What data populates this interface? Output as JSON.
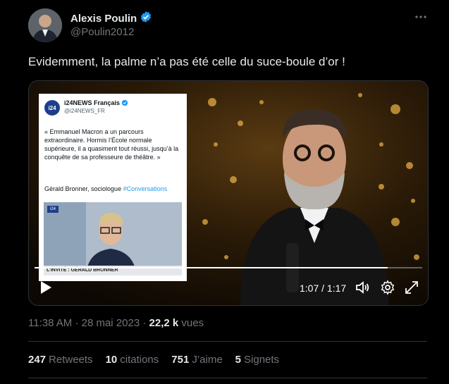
{
  "author": {
    "name": "Alexis Poulin",
    "handle": "@Poulin2012",
    "verified": true
  },
  "tweet_text": "Evidemment, la palme n’a pas été celle du suce-boule d’or !",
  "video": {
    "time_display": "1:07 / 1:17",
    "progress_fraction": 0.91,
    "embedded_card": {
      "account_name": "i24NEWS Français",
      "account_handle": "@i24NEWS_FR",
      "logo_text": "i24",
      "quote": "« Emmanuel Macron a un parcours extraordinaire. Hormis l’École normale supérieure, il a quasiment tout réussi, jusqu’à la conquête de sa professeure de théâtre. »",
      "signature_prefix": "Gérald Bronner, sociologue ",
      "signature_tag": "#Conversations",
      "clip_banner": "L’INVITÉ : GÉRALD BRONNER",
      "clip_badge": "i24"
    }
  },
  "meta": {
    "time": "11:38 AM",
    "separator": "·",
    "date": "28 mai 2023",
    "views_value": "22,2 k",
    "views_label": "vues"
  },
  "stats": {
    "retweets_value": "247",
    "retweets_label": "Retweets",
    "citations_value": "10",
    "citations_label": "citations",
    "likes_value": "751",
    "likes_label": "J’aime",
    "bookmarks_value": "5",
    "bookmarks_label": "Signets"
  },
  "colors": {
    "background": "#000000",
    "text": "#e7e9ea",
    "secondary": "#71767b",
    "accent": "#1d9bf0"
  }
}
